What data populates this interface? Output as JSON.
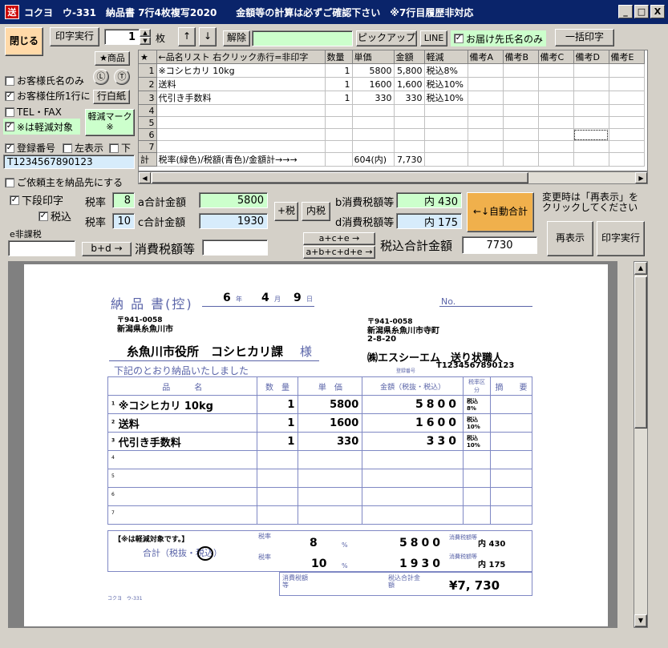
{
  "window": {
    "title": "コクヨ　ウ-331　納品書 7行4枚複写2020　　金額等の計算は必ずご確認下さい　※7行目履歴非対応",
    "app_icon": "送",
    "min": "_",
    "max": "□",
    "close": "X"
  },
  "toolbar": {
    "close_label": "閉じる",
    "print_label": "印字実行",
    "copies": "1",
    "copies_unit": "枚",
    "up": "↑",
    "down": "↓",
    "release_label": "解除",
    "pickup_label": "ピックアップ",
    "line_label": "LINE",
    "delivery_name_only": "お届け先氏名のみ",
    "batch_print_label": "一括印字"
  },
  "left": {
    "product_btn": "★商品",
    "customer_name_only": "お客様氏名のみ",
    "customer_address_one_line": "お客様住所1行に",
    "tel_fax": "TEL・FAX",
    "reduced_target": "※は軽減対象",
    "arrow_down_circle": "Ⓛ",
    "arrow_up_circle": "Ⓣ",
    "row_blank_btn": "行白紙",
    "reduced_mark_btn": "軽減マーク※",
    "reg_number": "登録番号",
    "left_display": "左表示",
    "bottom": "下",
    "reg_value": "T1234567890123",
    "consignor_delivery": "ご依頼主を納品先にする"
  },
  "grid": {
    "headers": [
      "★",
      "←品名リスト 右クリック赤行=非印字",
      "数量",
      "単価",
      "金額",
      "軽減",
      "備考A",
      "備考B",
      "備考C",
      "備考D",
      "備考E"
    ],
    "rows": [
      {
        "no": "1",
        "name": "※コシヒカリ 10kg",
        "qty": "1",
        "price": "5800",
        "amount": "5,800",
        "tax": "税込8%"
      },
      {
        "no": "2",
        "name": "送料",
        "qty": "1",
        "price": "1600",
        "amount": "1,600",
        "tax": "税込10%"
      },
      {
        "no": "3",
        "name": "代引き手数料",
        "qty": "1",
        "price": "330",
        "amount": "330",
        "tax": "税込10%"
      },
      {
        "no": "4",
        "name": "",
        "qty": "",
        "price": "",
        "amount": "",
        "tax": ""
      },
      {
        "no": "5",
        "name": "",
        "qty": "",
        "price": "",
        "amount": "",
        "tax": ""
      },
      {
        "no": "6",
        "name": "",
        "qty": "",
        "price": "",
        "amount": "",
        "tax": ""
      },
      {
        "no": "7",
        "name": "",
        "qty": "",
        "price": "",
        "amount": "",
        "tax": ""
      }
    ],
    "total": {
      "label": "計",
      "text": "税率(緑色)/税額(青色)/金額計→→→",
      "price": "604(内)",
      "amount": "7,730"
    }
  },
  "calc": {
    "lower_print": "下段印字",
    "tax_incl": "税込",
    "rate_label": "税率",
    "rate_a": "8",
    "rate_c": "10",
    "a_label": "a合計金額",
    "a_value": "5800",
    "c_label": "c合計金額",
    "c_value": "1930",
    "plus_tax": "+税",
    "incl_tax": "内税",
    "b_label": "b消費税額等",
    "b_value": "内 430",
    "d_label": "d消費税額等",
    "d_value": "内 175",
    "auto_total": "←↓自動合計",
    "notice": "変更時は「再表示」をクリックしてください",
    "e_label": "e非課税",
    "bd_btn": "b+d →",
    "tax_amount_label": "消費税額等",
    "ace_btn": "a+c+e →",
    "abcde_btn": "a+b+c+d+e →",
    "total_incl_label": "税込合計金額",
    "total_incl_value": "7730",
    "redisplay": "再表示",
    "print_exec": "印字実行"
  },
  "slip": {
    "title": "納 品 書(控)",
    "year": "6",
    "year_unit": "年",
    "month": "4",
    "month_unit": "月",
    "day": "9",
    "day_unit": "日",
    "no_label": "No.",
    "to_zip": "〒941-0058",
    "to_addr": "新潟県糸魚川市",
    "to_name": "糸魚川市役所　コシヒカリ課",
    "sama": "様",
    "from_zip": "〒941-0058",
    "from_addr1": "新潟県糸魚川市寺町",
    "from_addr2": "2-8-20",
    "from_name": "㈱エスシーエム　送り状職人",
    "reg_small": "登録番号",
    "reg": "T1234567890123",
    "greeting": "下記のとおり納品いたしました",
    "col_name": "品　　　名",
    "col_qty": "数　量",
    "col_price": "単　価",
    "col_amount": "金額（税抜・税込）",
    "col_tax": "税率区分",
    "col_note": "摘　　要",
    "rows": [
      {
        "no": "1",
        "name": "※コシヒカリ 10kg",
        "qty": "1",
        "price": "5800",
        "digits": [
          "5",
          "8",
          "0",
          "0"
        ],
        "tax": "税込8%"
      },
      {
        "no": "2",
        "name": "送料",
        "qty": "1",
        "price": "1600",
        "digits": [
          "1",
          "6",
          "0",
          "0"
        ],
        "tax": "税込10%"
      },
      {
        "no": "3",
        "name": "代引き手数料",
        "qty": "1",
        "price": "330",
        "digits": [
          "3",
          "3",
          "0"
        ],
        "tax": "税込10%"
      },
      {
        "no": "4",
        "name": "",
        "qty": "",
        "price": "",
        "digits": [],
        "tax": ""
      },
      {
        "no": "5",
        "name": "",
        "qty": "",
        "price": "",
        "digits": [],
        "tax": ""
      },
      {
        "no": "6",
        "name": "",
        "qty": "",
        "price": "",
        "digits": [],
        "tax": ""
      },
      {
        "no": "7",
        "name": "",
        "qty": "",
        "price": "",
        "digits": [],
        "tax": ""
      }
    ],
    "reduced_note": "【※は軽減対象です。】",
    "sum_label": "合計（税抜・税込）",
    "rate_label": "税率",
    "rate1": "8",
    "rate2": "10",
    "pct": "%",
    "sum1_digits": [
      "5",
      "8",
      "0",
      "0"
    ],
    "sum2_digits": [
      "1",
      "9",
      "3",
      "0"
    ],
    "tax_label": "消費税額等",
    "tax1": "内 430",
    "tax2": "内 175",
    "tax_amount_label": "消費税額　等",
    "total_label": "税込合計金額",
    "total": "¥7, 730",
    "footer": "コクヨ　ウ-331"
  }
}
